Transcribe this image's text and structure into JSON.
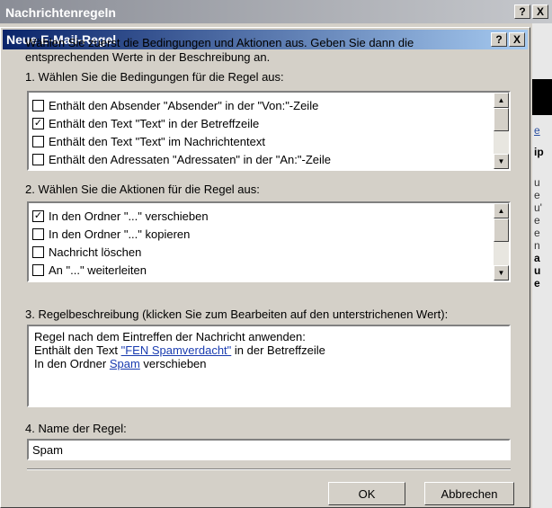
{
  "parent_window": {
    "title": "Nachrichtenregeln",
    "help_label": "?",
    "close_label": "X",
    "behind_fragments": [
      "e",
      "ip",
      "u",
      "e",
      "u'",
      "e",
      "e",
      "n",
      "a",
      "u",
      "e"
    ]
  },
  "dialog": {
    "title": "Neue E-Mail-Regel",
    "help_label": "?",
    "close_label": "X",
    "intro_line1": "Wählen Sie zuerst die Bedingungen und Aktionen aus. Geben Sie dann die",
    "intro_line2": "entsprechenden Werte in der Beschreibung an.",
    "step1_label": "1. Wählen Sie die Bedingungen für die Regel aus:",
    "conditions": [
      {
        "label": "Enthält den Absender \"Absender\" in der \"Von:\"-Zeile",
        "checked": false
      },
      {
        "label": "Enthält den Text \"Text\" in der Betreffzeile",
        "checked": true
      },
      {
        "label": "Enthält den Text \"Text\" im Nachrichtentext",
        "checked": false
      },
      {
        "label": "Enthält den Adressaten \"Adressaten\" in der \"An:\"-Zeile",
        "checked": false
      }
    ],
    "step2_label": "2. Wählen Sie die Aktionen für die Regel aus:",
    "actions": [
      {
        "label": "In den Ordner \"...\" verschieben",
        "checked": true
      },
      {
        "label": "In den Ordner \"...\" kopieren",
        "checked": false
      },
      {
        "label": "Nachricht löschen",
        "checked": false
      },
      {
        "label": "An \"...\" weiterleiten",
        "checked": false
      }
    ],
    "step3_label": "3. Regelbeschreibung (klicken Sie zum Bearbeiten auf den unterstrichenen Wert):",
    "description": {
      "line1": "Regel nach dem Eintreffen der Nachricht anwenden:",
      "line2_prefix": "Enthält den Text ",
      "line2_link": "\"FEN Spamverdacht\"",
      "line2_suffix": " in der Betreffzeile",
      "line3_prefix": "In den Ordner ",
      "line3_link": "Spam",
      "line3_suffix": " verschieben"
    },
    "step4_label": "4. Name der Regel:",
    "rule_name": "Spam",
    "ok_label": "OK",
    "cancel_label": "Abbrechen"
  }
}
